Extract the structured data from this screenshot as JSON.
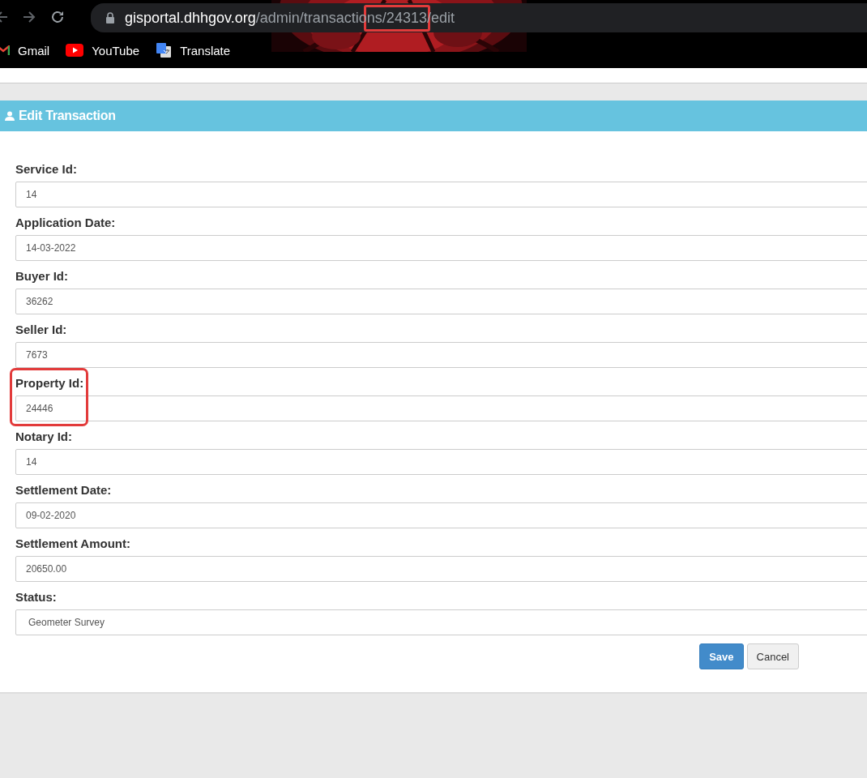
{
  "browser": {
    "url_host": "gisportal.dhhgov.org",
    "url_path": [
      {
        "text": "/admin/transactio",
        "highlighted": false
      },
      {
        "text": "ns/24313",
        "highlighted": true
      },
      {
        "text": "/edit",
        "highlighted": false
      }
    ],
    "bookmarks": [
      {
        "kind": "gmail",
        "label": "Gmail"
      },
      {
        "kind": "youtube",
        "label": "YouTube"
      },
      {
        "kind": "translate",
        "label": "Translate"
      }
    ]
  },
  "panel": {
    "title": "Edit Transaction"
  },
  "fields": [
    {
      "kind": "input",
      "label": "Service Id:",
      "value": "14",
      "highlighted": false
    },
    {
      "kind": "input",
      "label": "Application Date:",
      "value": "14-03-2022",
      "highlighted": false
    },
    {
      "kind": "input",
      "label": "Buyer Id:",
      "value": "36262",
      "highlighted": false
    },
    {
      "kind": "input",
      "label": "Seller Id:",
      "value": "7673",
      "highlighted": false
    },
    {
      "kind": "input",
      "label": "Property Id:",
      "value": "24446",
      "highlighted": true
    },
    {
      "kind": "input",
      "label": "Notary Id:",
      "value": "14",
      "highlighted": false
    },
    {
      "kind": "input",
      "label": "Settlement Date:",
      "value": "09-02-2020",
      "highlighted": false
    },
    {
      "kind": "input",
      "label": "Settlement Amount:",
      "value": "20650.00",
      "highlighted": false
    },
    {
      "kind": "select",
      "label": "Status:",
      "value": "Geometer Survey",
      "highlighted": false
    }
  ],
  "buttons": [
    {
      "kind": "primary",
      "label": "Save"
    },
    {
      "kind": "default",
      "label": "Cancel"
    }
  ]
}
